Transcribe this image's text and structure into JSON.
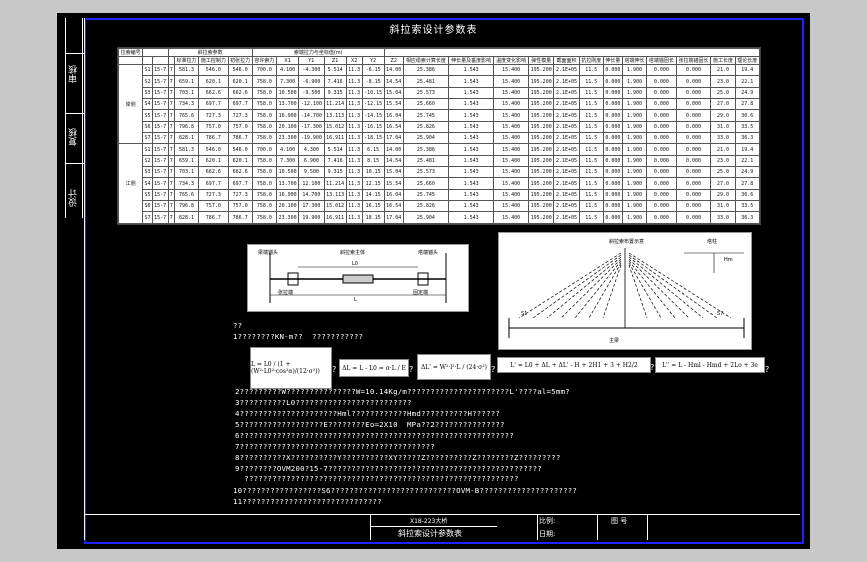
{
  "sheet_title": "斜拉索设计参数表",
  "side_labels": [
    "审核",
    "复核",
    "设计"
  ],
  "table": {
    "header_row1": [
      "拉索编号",
      "钢绞线根数",
      "每束根数",
      "斜拉索参数",
      "",
      "",
      "索端拉力与坐标值(m)",
      "",
      "",
      "",
      "",
      "",
      "相应缆索计算长度",
      "伸长量及垂度影响",
      "温度变化影响",
      "弹性模量",
      "截面面积",
      "抗拉刚度",
      "伸长量",
      "塔端伸长",
      "塔端锚固长",
      "张拉端锚固长",
      "施工长度",
      "理论长度",
      "下料长度"
    ],
    "header_row2": [
      "",
      "",
      "",
      "单(kN)",
      "设计索力",
      "容许索力",
      "主梁",
      "",
      "",
      "塔柱",
      "",
      ""
    ],
    "header_row3": [
      "",
      "",
      "",
      "标准拉力",
      "施工控制力",
      "初张拉力",
      "容许索力",
      "X1",
      "Y1",
      "Z1",
      "X2",
      "Y2",
      "Z2"
    ],
    "group_labels": [
      "岸侧",
      "江侧"
    ],
    "rows": [
      [
        "S1",
        "15-7",
        "7",
        "581.3",
        "546.0",
        "546.0",
        "700.0",
        "4.100",
        "-4.300",
        "5.514",
        "11.3",
        "-6.15",
        "14.00",
        "25.386",
        "1.543",
        "15.400",
        "195.200",
        "2.1E+05",
        "11.5",
        "0.000",
        "1.900",
        "0.000",
        "0.000",
        "21.0",
        "19.4"
      ],
      [
        "S2",
        "15-7",
        "7",
        "659.1",
        "620.1",
        "620.1",
        "758.0",
        "7.300",
        "-6.900",
        "7.416",
        "11.3",
        "-8.15",
        "14.54",
        "25.481",
        "1.543",
        "15.400",
        "195.200",
        "2.1E+05",
        "11.5",
        "0.000",
        "1.900",
        "0.000",
        "0.000",
        "23.0",
        "22.1"
      ],
      [
        "S3",
        "15-7",
        "7",
        "703.1",
        "662.6",
        "662.6",
        "758.0",
        "10.500",
        "-9.500",
        "9.315",
        "11.3",
        "-10.15",
        "15.04",
        "25.573",
        "1.543",
        "15.400",
        "195.200",
        "2.1E+05",
        "11.5",
        "0.000",
        "1.900",
        "0.000",
        "0.000",
        "25.0",
        "24.9"
      ],
      [
        "S4",
        "15-7",
        "7",
        "734.3",
        "697.7",
        "697.7",
        "758.0",
        "13.700",
        "-12.100",
        "11.214",
        "11.3",
        "-12.15",
        "15.54",
        "25.660",
        "1.543",
        "15.400",
        "195.200",
        "2.1E+05",
        "11.5",
        "0.000",
        "1.900",
        "0.000",
        "0.000",
        "27.0",
        "27.8"
      ],
      [
        "S5",
        "15-7",
        "7",
        "765.6",
        "727.3",
        "727.3",
        "758.0",
        "16.900",
        "-14.700",
        "13.113",
        "11.3",
        "-14.15",
        "16.04",
        "25.745",
        "1.543",
        "15.400",
        "195.200",
        "2.1E+05",
        "11.5",
        "0.000",
        "1.900",
        "0.000",
        "0.000",
        "29.0",
        "30.6"
      ],
      [
        "S6",
        "15-7",
        "7",
        "796.8",
        "757.0",
        "757.0",
        "758.0",
        "20.100",
        "-17.300",
        "15.012",
        "11.3",
        "-16.15",
        "16.54",
        "25.826",
        "1.543",
        "15.400",
        "195.200",
        "2.1E+05",
        "11.5",
        "0.000",
        "1.900",
        "0.000",
        "0.000",
        "31.0",
        "33.5"
      ],
      [
        "S7",
        "15-7",
        "7",
        "828.1",
        "786.7",
        "786.7",
        "758.0",
        "23.300",
        "-19.900",
        "16.911",
        "11.3",
        "-18.15",
        "17.04",
        "25.904",
        "1.543",
        "15.400",
        "195.200",
        "2.1E+05",
        "11.5",
        "0.000",
        "1.900",
        "0.000",
        "0.000",
        "33.0",
        "36.3"
      ],
      [
        "S1",
        "15-7",
        "7",
        "581.3",
        "546.0",
        "546.0",
        "700.0",
        "4.100",
        "4.300",
        "5.514",
        "11.3",
        "6.15",
        "14.00",
        "25.386",
        "1.543",
        "15.400",
        "195.200",
        "2.1E+05",
        "11.5",
        "0.000",
        "1.900",
        "0.000",
        "0.000",
        "21.0",
        "19.4"
      ],
      [
        "S2",
        "15-7",
        "7",
        "659.1",
        "620.1",
        "620.1",
        "758.0",
        "7.300",
        "6.900",
        "7.416",
        "11.3",
        "8.15",
        "14.54",
        "25.481",
        "1.543",
        "15.400",
        "195.200",
        "2.1E+05",
        "11.5",
        "0.000",
        "1.900",
        "0.000",
        "0.000",
        "23.0",
        "22.1"
      ],
      [
        "S3",
        "15-7",
        "7",
        "703.1",
        "662.6",
        "662.6",
        "758.0",
        "10.500",
        "9.500",
        "9.315",
        "11.3",
        "10.15",
        "15.04",
        "25.573",
        "1.543",
        "15.400",
        "195.200",
        "2.1E+05",
        "11.5",
        "0.000",
        "1.900",
        "0.000",
        "0.000",
        "25.0",
        "24.9"
      ],
      [
        "S4",
        "15-7",
        "7",
        "734.3",
        "697.7",
        "697.7",
        "758.0",
        "13.700",
        "12.100",
        "11.214",
        "11.3",
        "12.15",
        "15.54",
        "25.660",
        "1.543",
        "15.400",
        "195.200",
        "2.1E+05",
        "11.5",
        "0.000",
        "1.900",
        "0.000",
        "0.000",
        "27.0",
        "27.8"
      ],
      [
        "S5",
        "15-7",
        "7",
        "765.6",
        "727.3",
        "727.3",
        "758.0",
        "16.900",
        "14.700",
        "13.113",
        "11.3",
        "14.15",
        "16.04",
        "25.745",
        "1.543",
        "15.400",
        "195.200",
        "2.1E+05",
        "11.5",
        "0.000",
        "1.900",
        "0.000",
        "0.000",
        "29.0",
        "30.6"
      ],
      [
        "S6",
        "15-7",
        "7",
        "796.8",
        "757.0",
        "757.0",
        "758.0",
        "20.100",
        "17.300",
        "15.012",
        "11.3",
        "16.15",
        "16.54",
        "25.826",
        "1.543",
        "15.400",
        "195.200",
        "2.1E+05",
        "11.5",
        "0.000",
        "1.900",
        "0.000",
        "0.000",
        "31.0",
        "33.5"
      ],
      [
        "S7",
        "15-7",
        "7",
        "828.1",
        "786.7",
        "786.7",
        "758.0",
        "23.300",
        "19.900",
        "16.911",
        "11.3",
        "18.15",
        "17.04",
        "25.904",
        "1.543",
        "15.400",
        "195.200",
        "2.1E+05",
        "11.5",
        "0.000",
        "1.900",
        "0.000",
        "0.000",
        "33.0",
        "36.3"
      ]
    ]
  },
  "diagram_left": {
    "labels": [
      "梁端锚头",
      "斜拉索主体",
      "塔端锚头",
      "张拉端",
      "固定端",
      "L0",
      "L"
    ]
  },
  "diagram_right": {
    "title": "斜拉索布置示意",
    "labels": [
      "S1",
      "S7",
      "主梁",
      "塔柱",
      "Hm"
    ]
  },
  "notes_header": "??",
  "notes": [
    "1????????KN-m??  ???????????",
    "2?????????W???????????????W=10.14Kg/m??????????????????????L'????al=5mm?",
    "3??????????L0?????????????????????????",
    "4?????????????????????Hml????????????Hmd??????????H??????",
    "5??????????????????E????????Eo=2X10  MPa??2???????????????",
    "6???????????????????????????????????????????????????????????",
    "7??????????????????????????????????????????",
    "8??????????X??????????Y??????????XY?????Z??????????Z????????Z?????????",
    "9????????OVM200?15-7??????????????????????????????????????????????",
    "  ???????????????????????????????????????????????????????????",
    "10?????????????????S6???????????????????????????OVM-B?????????????????????",
    "11??????????????????????????????"
  ],
  "formulas": [
    "L = L0 / (1 + (W²·L0²·cos²α)/(12·σ²))",
    "ΔL = L - L0 = σ·L / E",
    "ΔL' = W²·l²·L / (24·σ²)",
    "L' = L0 + ΔL + ΔL' - H + 2H1 + 3 + H2/2",
    "L'' = L - Hml - Hmd + 2Lo + 3e"
  ],
  "title_block": {
    "project": "X18-223大桥",
    "drawing_name": "斜拉索设计参数表",
    "scale_label": "比例:",
    "date_label": "日期:",
    "drawing_no_label": "图  号"
  }
}
